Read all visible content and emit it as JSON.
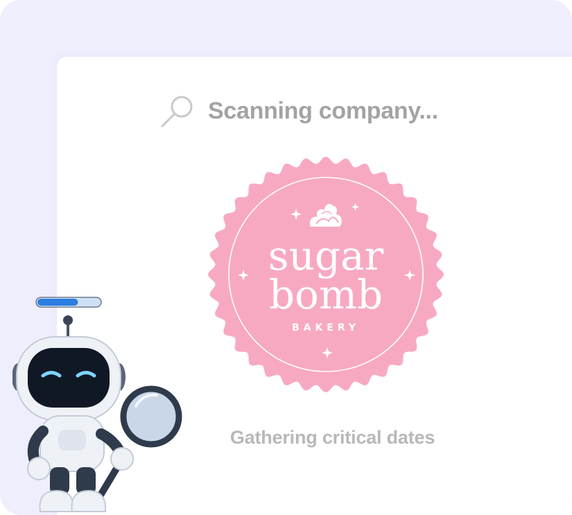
{
  "scan": {
    "label": "Scanning company...",
    "icon": "search-icon"
  },
  "company_logo": {
    "line1": "sugar",
    "line2": "bomb",
    "line3": "BAKERY",
    "badge_color": "#f8a9c2",
    "text_color": "#ffffff"
  },
  "status": {
    "label": "Gathering critical dates"
  },
  "robot": {
    "progress": 0.65,
    "progress_color": "#2d7de0"
  },
  "colors": {
    "background": "#efeefd",
    "card": "#ffffff",
    "muted_text": "#a3a3a3"
  }
}
